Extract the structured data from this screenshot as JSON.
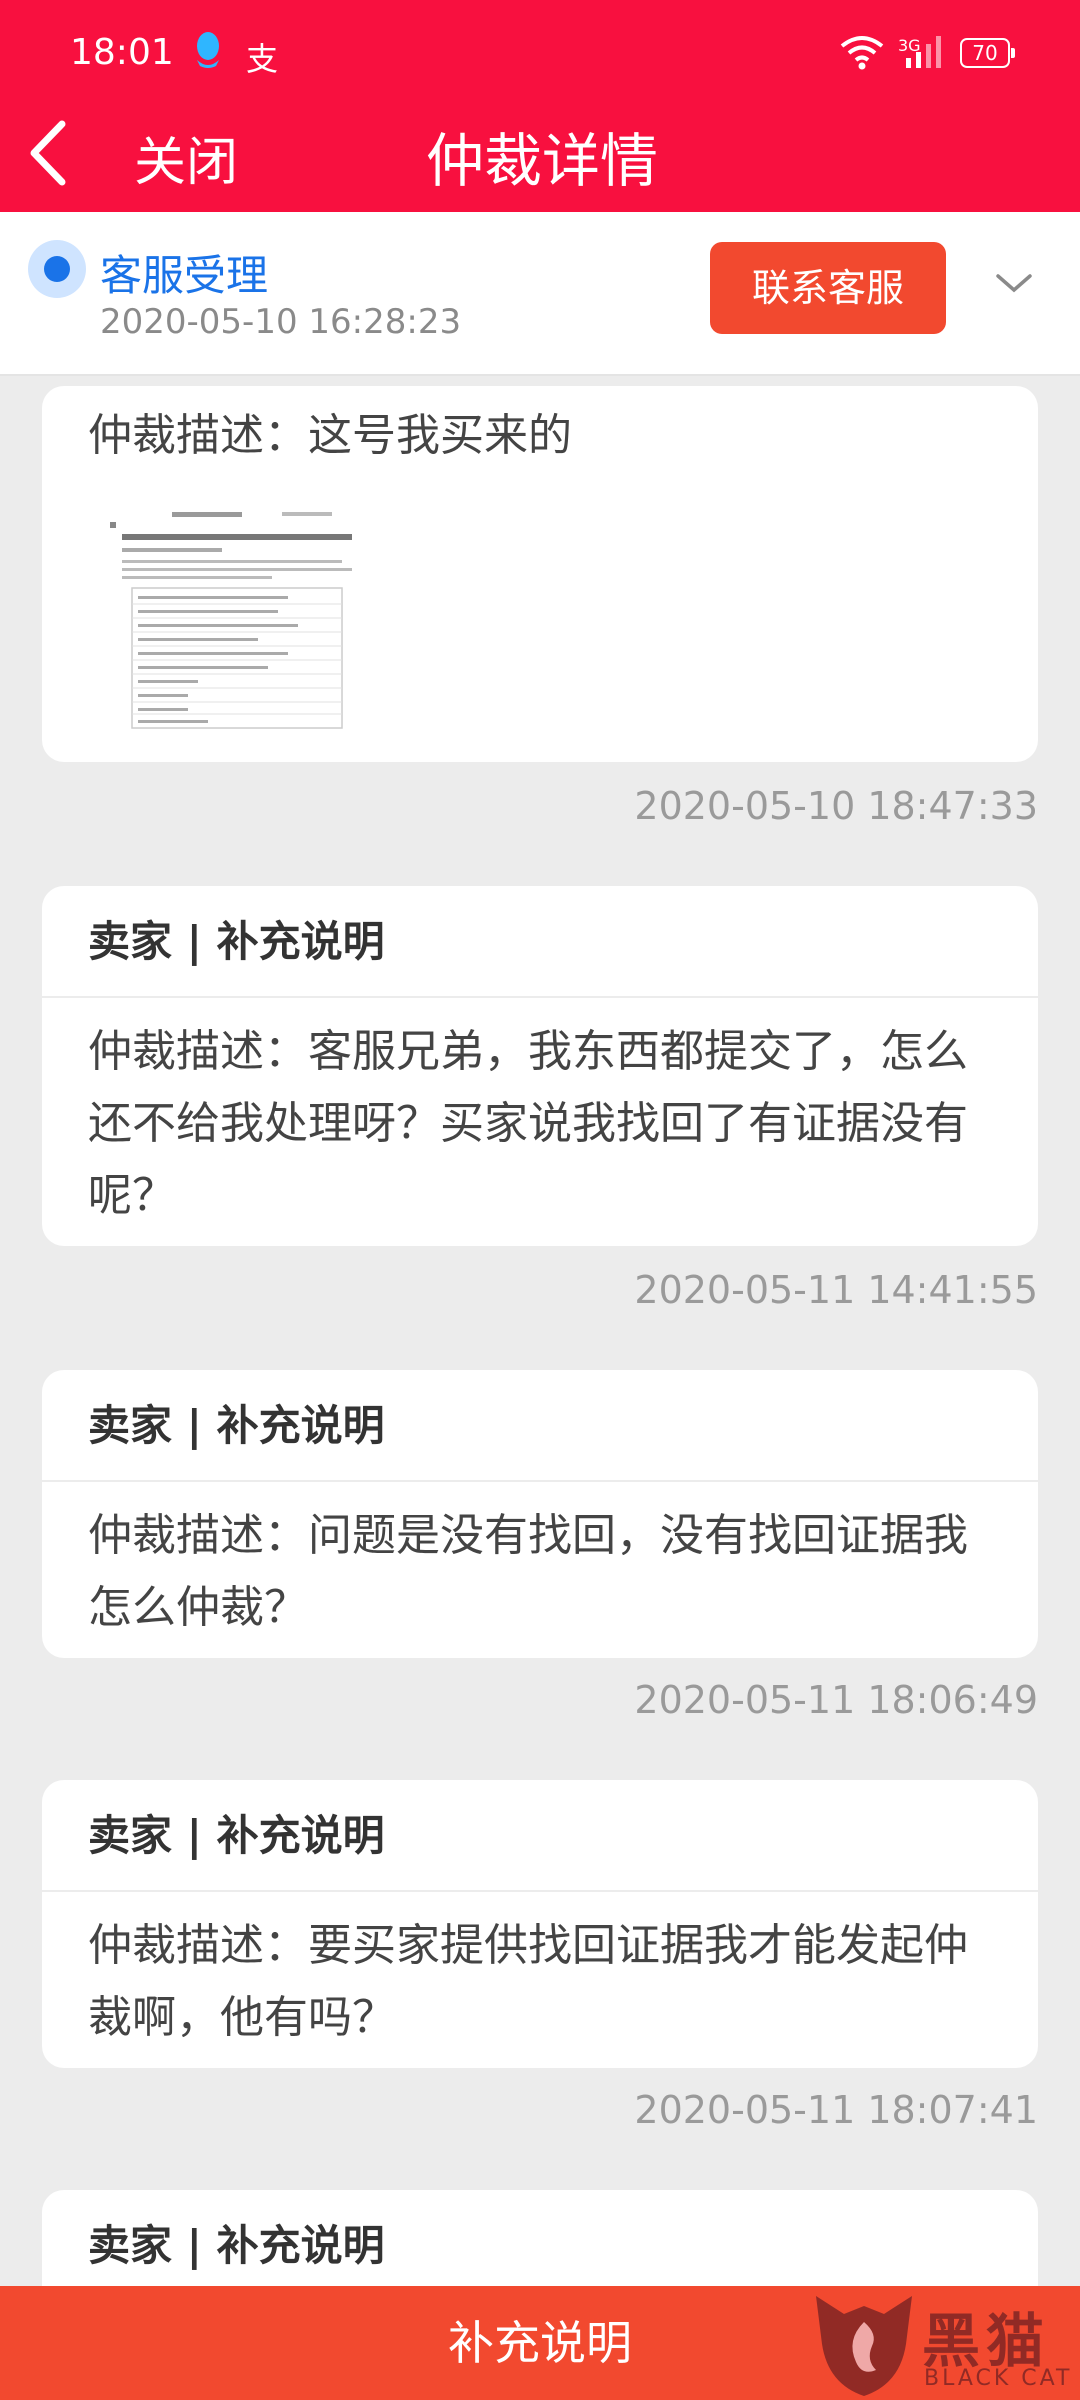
{
  "status_bar": {
    "time": "18:01",
    "pay_glyph": "支",
    "network": "3G",
    "battery": "70"
  },
  "nav": {
    "close_label": "关闭",
    "title": "仲裁详情"
  },
  "case_status": {
    "stage": "客服受理",
    "time": "2020-05-10 16:28:23",
    "contact_label": "联系客服"
  },
  "entries": [
    {
      "description": "仲裁描述：这号我买来的",
      "has_image": true,
      "time": "2020-05-10 18:47:33"
    },
    {
      "header": "卖家 | 补充说明",
      "description": "仲裁描述：客服兄弟，我东西都提交了，怎么还不给我处理呀？买家说我找回了有证据没有呢？",
      "time": "2020-05-11 14:41:55"
    },
    {
      "header": "卖家 | 补充说明",
      "description": "仲裁描述：问题是没有找回，没有找回证据我怎么仲裁？",
      "time": "2020-05-11 18:06:49"
    },
    {
      "header": "卖家 | 补充说明",
      "description": "仲裁描述：要买家提供找回证据我才能发起仲裁啊，他有吗？",
      "time": "2020-05-11 18:07:41"
    },
    {
      "header": "卖家 | 补充说明"
    }
  ],
  "bottom": {
    "action_label": "补充说明"
  },
  "watermark": {
    "brand": "黑猫",
    "sub": "BLACK CAT"
  },
  "colors": {
    "header_red": "#f8103f",
    "button_red": "#f2492f",
    "accent_blue": "#1a73e8"
  },
  "icons": [
    "qq-icon",
    "wifi-icon",
    "signal-icon",
    "battery-icon",
    "back-arrow-icon",
    "chevron-down-icon",
    "blackcat-logo-icon"
  ]
}
